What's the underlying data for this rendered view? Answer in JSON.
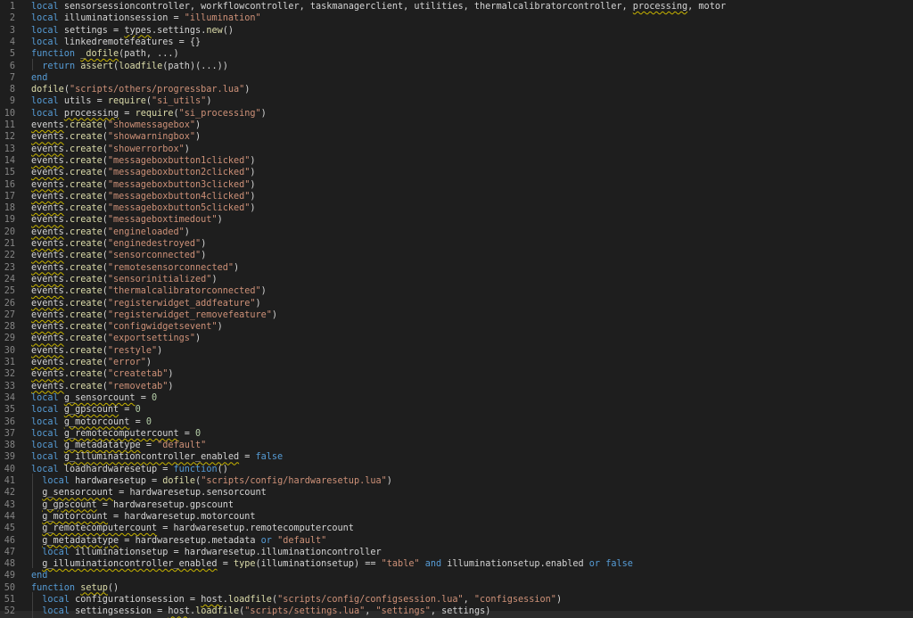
{
  "editor": {
    "lines": [
      {
        "n": "1",
        "text": "local sensorsessioncontroller, workflowcontroller, taskmanagerclient, utilities, thermalcalibratorcontroller, processing, motor"
      },
      {
        "n": "2",
        "text": "local illuminationsession = \"illumination\""
      },
      {
        "n": "3",
        "text": "local settings = types.settings.new()"
      },
      {
        "n": "4",
        "text": "local linkedremotefeatures = {}"
      },
      {
        "n": "5",
        "text": "function _dofile(path, ...)"
      },
      {
        "n": "6",
        "text": "  return assert(loadfile(path)(...))"
      },
      {
        "n": "7",
        "text": "end"
      },
      {
        "n": "8",
        "text": "dofile(\"scripts/others/progressbar.lua\")"
      },
      {
        "n": "9",
        "text": "local utils = require(\"si_utils\")"
      },
      {
        "n": "10",
        "text": "local processing = require(\"si_processing\")"
      },
      {
        "n": "11",
        "text": "events.create(\"showmessagebox\")"
      },
      {
        "n": "12",
        "text": "events.create(\"showwarningbox\")"
      },
      {
        "n": "13",
        "text": "events.create(\"showerrorbox\")"
      },
      {
        "n": "14",
        "text": "events.create(\"messageboxbutton1clicked\")"
      },
      {
        "n": "15",
        "text": "events.create(\"messageboxbutton2clicked\")"
      },
      {
        "n": "16",
        "text": "events.create(\"messageboxbutton3clicked\")"
      },
      {
        "n": "17",
        "text": "events.create(\"messageboxbutton4clicked\")"
      },
      {
        "n": "18",
        "text": "events.create(\"messageboxbutton5clicked\")"
      },
      {
        "n": "19",
        "text": "events.create(\"messageboxtimedout\")"
      },
      {
        "n": "20",
        "text": "events.create(\"engineloaded\")"
      },
      {
        "n": "21",
        "text": "events.create(\"enginedestroyed\")"
      },
      {
        "n": "22",
        "text": "events.create(\"sensorconnected\")"
      },
      {
        "n": "23",
        "text": "events.create(\"remotesensorconnected\")"
      },
      {
        "n": "24",
        "text": "events.create(\"sensorinitialized\")"
      },
      {
        "n": "25",
        "text": "events.create(\"thermalcalibratorconnected\")"
      },
      {
        "n": "26",
        "text": "events.create(\"registerwidget_addfeature\")"
      },
      {
        "n": "27",
        "text": "events.create(\"registerwidget_removefeature\")"
      },
      {
        "n": "28",
        "text": "events.create(\"configwidgetsevent\")"
      },
      {
        "n": "29",
        "text": "events.create(\"exportsettings\")"
      },
      {
        "n": "30",
        "text": "events.create(\"restyle\")"
      },
      {
        "n": "31",
        "text": "events.create(\"error\")"
      },
      {
        "n": "32",
        "text": "events.create(\"createtab\")"
      },
      {
        "n": "33",
        "text": "events.create(\"removetab\")"
      },
      {
        "n": "34",
        "text": "local g_sensorcount = 0"
      },
      {
        "n": "35",
        "text": "local g_gpscount = 0"
      },
      {
        "n": "36",
        "text": "local g_motorcount = 0"
      },
      {
        "n": "37",
        "text": "local g_remotecomputercount = 0"
      },
      {
        "n": "38",
        "text": "local g_metadatatype = \"default\""
      },
      {
        "n": "39",
        "text": "local g_illuminationcontroller_enabled = false"
      },
      {
        "n": "40",
        "text": "local loadhardwaresetup = function()"
      },
      {
        "n": "41",
        "text": "  local hardwaresetup = dofile(\"scripts/config/hardwaresetup.lua\")"
      },
      {
        "n": "42",
        "text": "  g_sensorcount = hardwaresetup.sensorcount"
      },
      {
        "n": "43",
        "text": "  g_gpscount = hardwaresetup.gpscount"
      },
      {
        "n": "44",
        "text": "  g_motorcount = hardwaresetup.motorcount"
      },
      {
        "n": "45",
        "text": "  g_remotecomputercount = hardwaresetup.remotecomputercount"
      },
      {
        "n": "46",
        "text": "  g_metadatatype = hardwaresetup.metadata or \"default\""
      },
      {
        "n": "47",
        "text": "  local illuminationsetup = hardwaresetup.illuminationcontroller"
      },
      {
        "n": "48",
        "text": "  g_illuminationcontroller_enabled = type(illuminationsetup) == \"table\" and illuminationsetup.enabled or false"
      },
      {
        "n": "49",
        "text": "end"
      },
      {
        "n": "50",
        "text": "function setup()"
      },
      {
        "n": "51",
        "text": "  local configurationsession = host.loadfile(\"scripts/config/configsession.lua\", \"configsession\")"
      },
      {
        "n": "52",
        "text": "  local settingsession = host.loadfile(\"scripts/settings.lua\", \"settings\", settings)"
      }
    ]
  },
  "colors": {
    "background": "#1e1e1e",
    "line_number": "#858585",
    "keyword": "#569cd6",
    "string": "#ce9178",
    "number": "#b5cea8",
    "function": "#dcdcaa",
    "text": "#d4d4d4"
  }
}
